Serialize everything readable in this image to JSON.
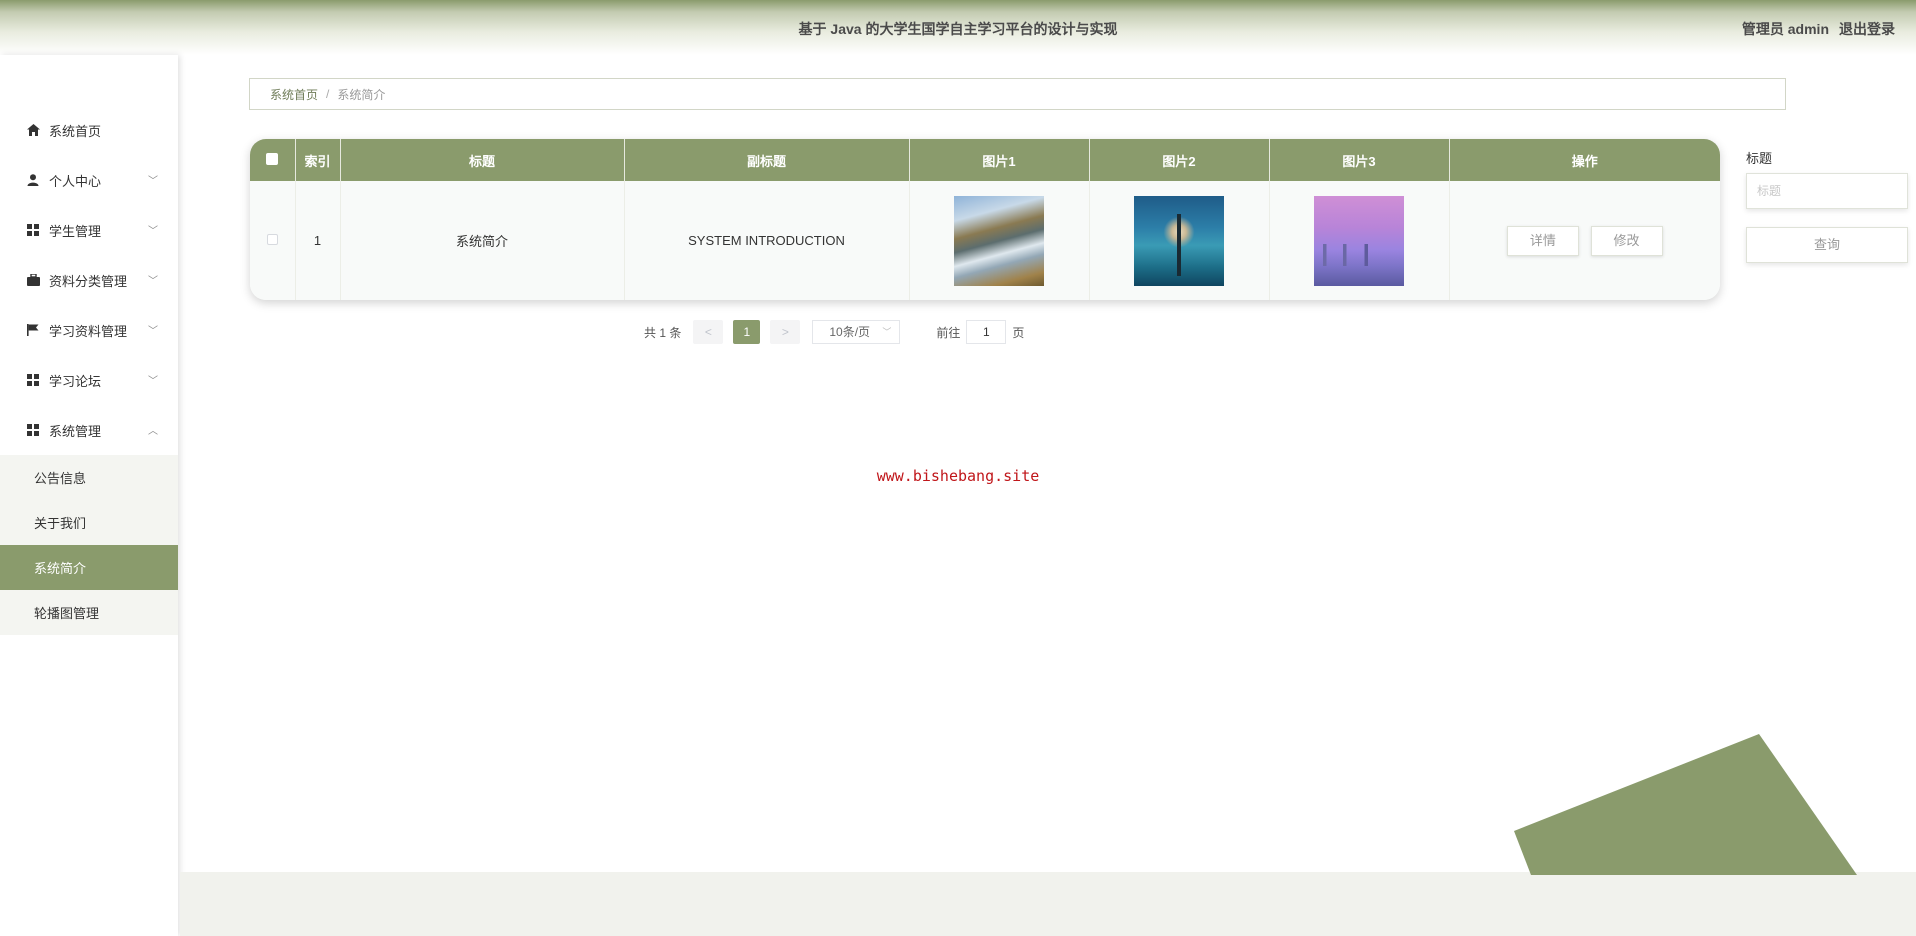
{
  "header": {
    "title": "基于 Java 的大学生国学自主学习平台的设计与实现",
    "user_label": "管理员 admin",
    "logout_label": "退出登录"
  },
  "sidebar": {
    "items": [
      {
        "label": "系统首页",
        "icon": "home-icon"
      },
      {
        "label": "个人中心",
        "icon": "user-icon",
        "expandable": true
      },
      {
        "label": "学生管理",
        "icon": "grid-icon",
        "expandable": true
      },
      {
        "label": "资料分类管理",
        "icon": "briefcase-icon",
        "expandable": true
      },
      {
        "label": "学习资料管理",
        "icon": "flag-icon",
        "expandable": true
      },
      {
        "label": "学习论坛",
        "icon": "grid-icon",
        "expandable": true
      },
      {
        "label": "系统管理",
        "icon": "grid-icon",
        "expandable": true,
        "expanded": true
      }
    ],
    "submenu": [
      {
        "label": "公告信息"
      },
      {
        "label": "关于我们"
      },
      {
        "label": "系统简介",
        "active": true
      },
      {
        "label": "轮播图管理"
      }
    ]
  },
  "breadcrumb": {
    "home": "系统首页",
    "separator": "/",
    "current": "系统简介"
  },
  "table": {
    "headers": [
      "索引",
      "标题",
      "副标题",
      "图片1",
      "图片2",
      "图片3",
      "操作"
    ],
    "rows": [
      {
        "index": "1",
        "title": "系统简介",
        "subtitle": "SYSTEM INTRODUCTION"
      }
    ],
    "detail_label": "详情",
    "edit_label": "修改"
  },
  "pagination": {
    "total": "共 1 条",
    "prev": "<",
    "current_page": "1",
    "next": ">",
    "page_size": "10条/页",
    "goto_prefix": "前往",
    "goto_value": "1",
    "goto_suffix": "页"
  },
  "search": {
    "label": "标题",
    "placeholder": "标题",
    "button_label": "查询"
  },
  "watermark": "www.bishebang.site",
  "colors": {
    "accent": "#8a9b6c",
    "watermark": "#c0161a"
  }
}
